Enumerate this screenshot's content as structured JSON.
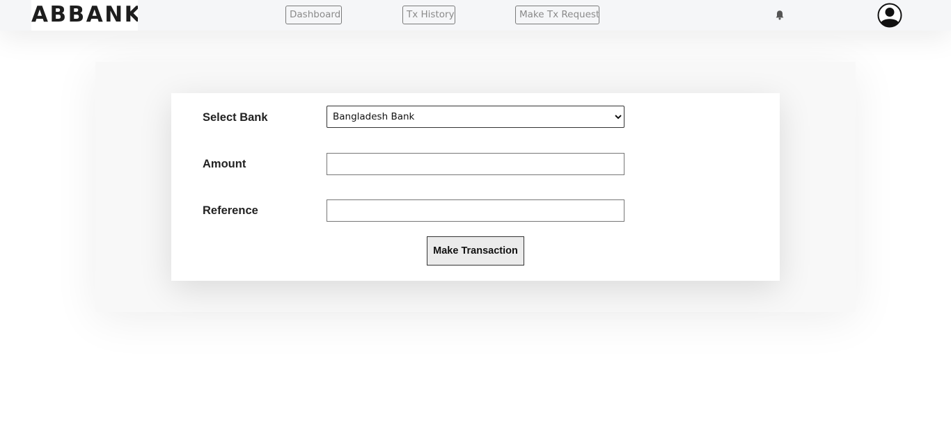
{
  "brand": {
    "name": "ABBANK"
  },
  "nav": {
    "dashboard_label": "Dashboard",
    "tx_history_label": "Tx History",
    "make_tx_request_label": "Make Tx Request"
  },
  "icons": {
    "notification": "bell-icon",
    "profile": "user-avatar-icon"
  },
  "form": {
    "bank_label": "Select Bank",
    "bank_selected": "Bangladesh Bank",
    "bank_options": [
      "Bangladesh Bank"
    ],
    "amount_label": "Amount",
    "amount_value": "",
    "reference_label": "Reference",
    "reference_value": "",
    "submit_label": "Make Transaction"
  },
  "colors": {
    "navbar_bg": "#f5f6f8",
    "card_bg": "#f8f8f8",
    "nav_button_text": "#8a8a8a"
  }
}
